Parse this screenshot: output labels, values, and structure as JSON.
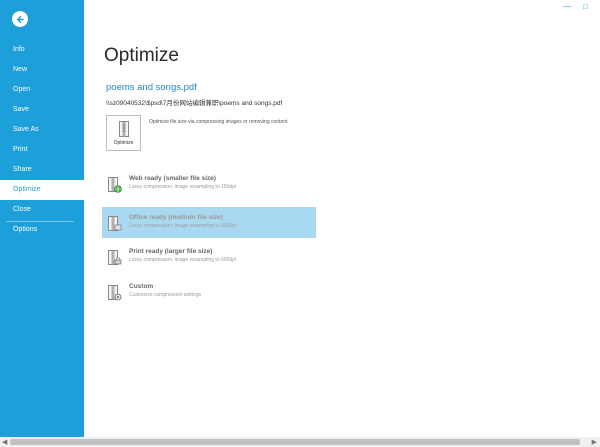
{
  "nav": {
    "items": [
      {
        "label": "Info"
      },
      {
        "label": "New"
      },
      {
        "label": "Open"
      },
      {
        "label": "Save"
      },
      {
        "label": "Save As"
      },
      {
        "label": "Print"
      },
      {
        "label": "Share"
      },
      {
        "label": "Optimize",
        "active": true
      },
      {
        "label": "Close"
      },
      {
        "label": "Options"
      }
    ]
  },
  "window": {
    "minimize": "—",
    "maximize": "□"
  },
  "main": {
    "title": "Optimize",
    "filename": "poems and songs.pdf",
    "filepath": "\\\\sz09040532\\$psd\\7月份网站编辑兼职\\poems and songs.pdf",
    "optimize_button": "Optimize",
    "optimize_desc": "Optimize file size via compressing images or removing content."
  },
  "options": [
    {
      "title": "Web ready (smaller file size)",
      "desc": "Lossy compression; image resampling to 150dpi",
      "icon": "web-ready-icon"
    },
    {
      "title": "Office ready (medium file size)",
      "desc": "Lossy compression; image resampling to 300dpi",
      "icon": "office-ready-icon",
      "selected": true
    },
    {
      "title": "Print ready (larger file size)",
      "desc": "Lossy compression; image resampling to 600dpi",
      "icon": "print-ready-icon"
    },
    {
      "title": "Custom",
      "desc": "Customize compression settings",
      "icon": "custom-gear-icon"
    }
  ],
  "colors": {
    "accent": "#1d9fd9",
    "selected": "#a8d9f0",
    "link": "#1e88c6"
  }
}
